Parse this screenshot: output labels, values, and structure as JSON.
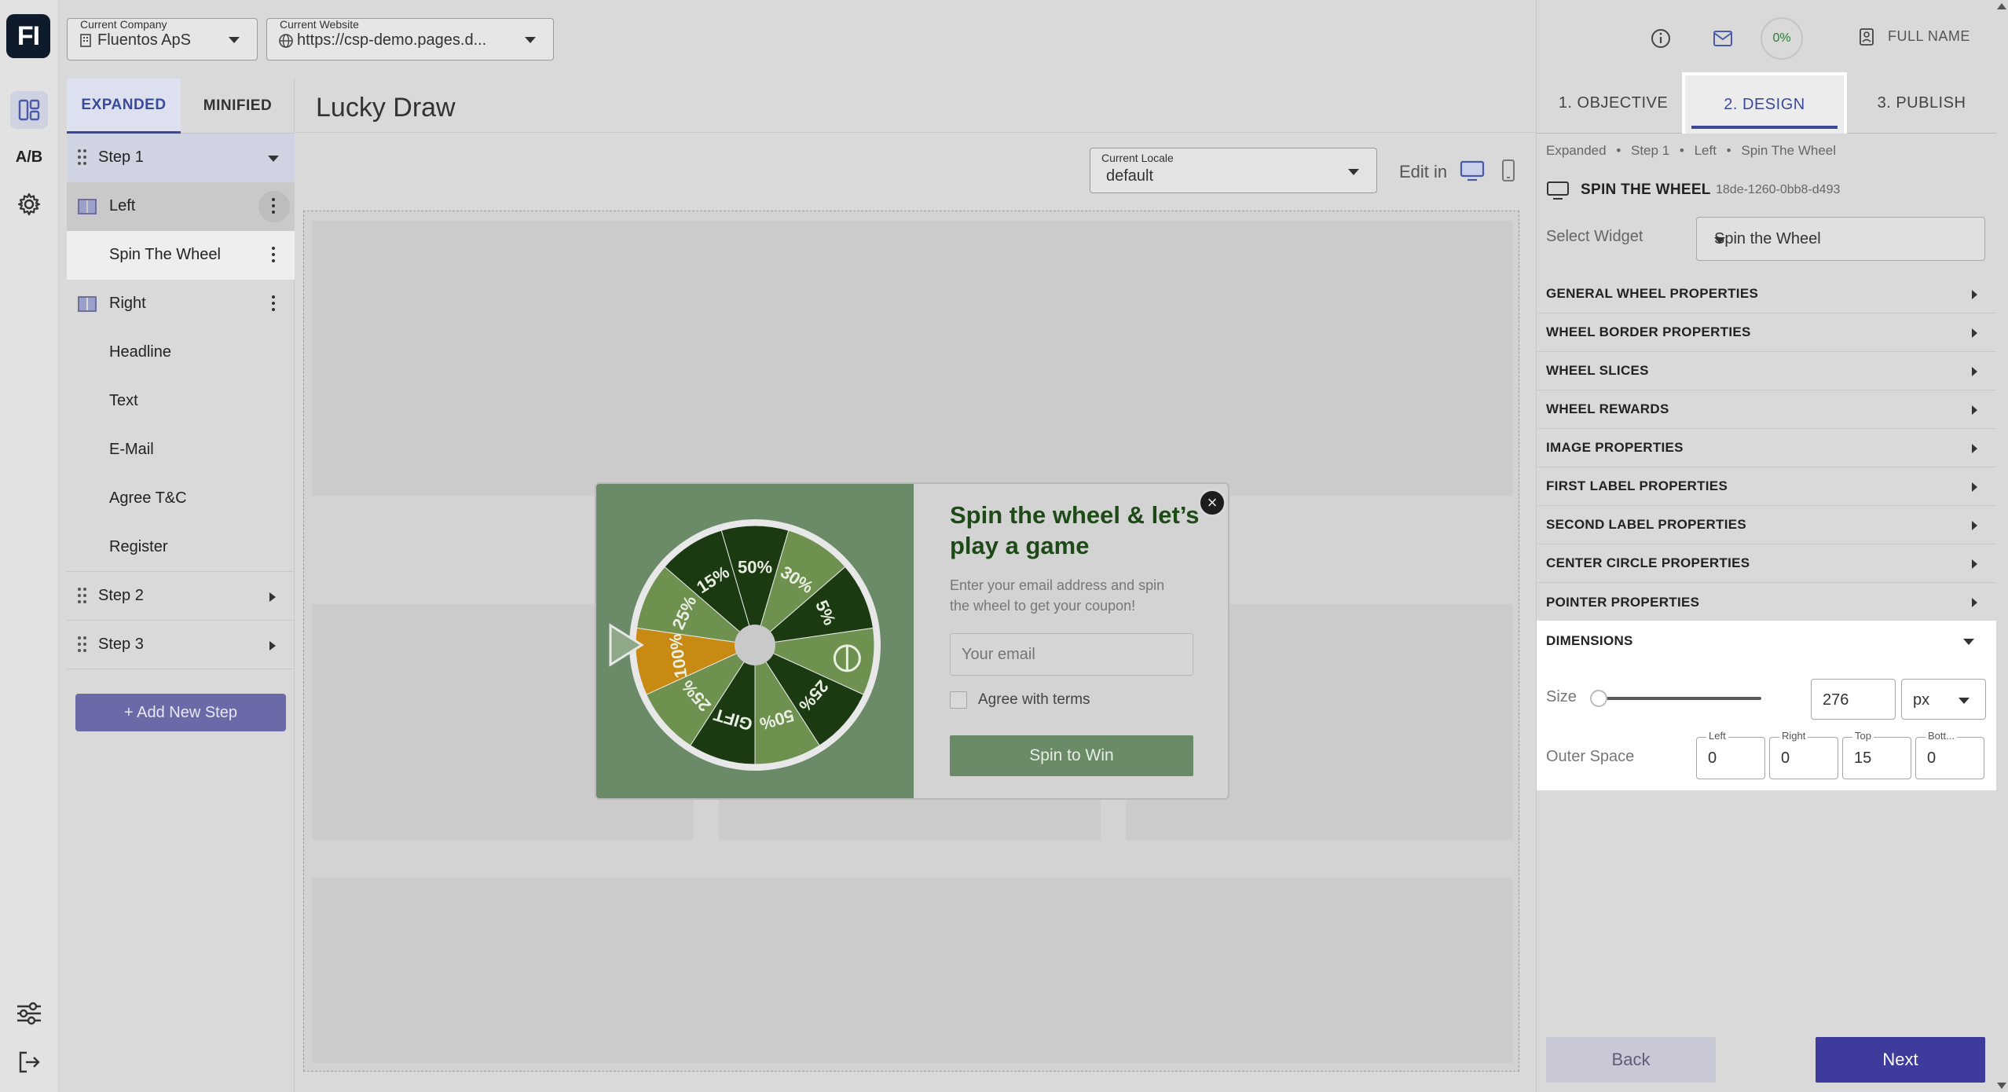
{
  "app": {
    "logo_text": "FI",
    "ab_label": "A/B"
  },
  "topbar": {
    "company": {
      "label": "Current Company",
      "value": "Fluentos ApS"
    },
    "website": {
      "label": "Current Website",
      "value": "https://csp-demo.pages.d..."
    }
  },
  "tree": {
    "tabs": [
      {
        "label": "EXPANDED",
        "active": true
      },
      {
        "label": "MINIFIED",
        "active": false
      }
    ],
    "items": {
      "step1": "Step 1",
      "left": "Left",
      "spin_wheel": "Spin The Wheel",
      "right": "Right",
      "headline": "Headline",
      "text": "Text",
      "email": "E-Mail",
      "agree": "Agree T&C",
      "register": "Register",
      "step2": "Step 2",
      "step3": "Step 3"
    },
    "add_step": "+ Add New Step"
  },
  "main": {
    "title": "Lucky Draw",
    "locale": {
      "label": "Current Locale",
      "value": "default"
    },
    "edit_in": "Edit in"
  },
  "popup": {
    "headline": "Spin the wheel & let’s play a game",
    "text": "Enter your email address and spin the wheel to get your coupon!",
    "email_placeholder": "Your email",
    "agree_label": "Agree with terms",
    "button": "Spin to Win",
    "close": "×",
    "wheel_slices": [
      "50%",
      "30%",
      "5%",
      "",
      "25%",
      "50%",
      "GIFT",
      "25%",
      "100%",
      "25%",
      "15%"
    ]
  },
  "panel": {
    "progress": "0%",
    "user": "FULL NAME",
    "tabs": [
      "1. OBJECTIVE",
      "2. DESIGN",
      "3. PUBLISH"
    ],
    "breadcrumb": [
      "Expanded",
      "Step 1",
      "Left",
      "Spin The Wheel"
    ],
    "widget_title": "SPIN THE WHEEL",
    "widget_id": "18de-1260-0bb8-d493",
    "select_widget_label": "Select Widget",
    "select_widget_value": "Spin the Wheel",
    "properties": [
      "GENERAL WHEEL PROPERTIES",
      "WHEEL BORDER PROPERTIES",
      "WHEEL SLICES",
      "WHEEL REWARDS",
      "IMAGE PROPERTIES",
      "FIRST LABEL PROPERTIES",
      "SECOND LABEL PROPERTIES",
      "CENTER CIRCLE PROPERTIES",
      "POINTER PROPERTIES"
    ],
    "dimensions": {
      "title": "DIMENSIONS",
      "size_label": "Size",
      "size_value": "276",
      "unit": "px",
      "outer_label": "Outer Space",
      "fields": [
        {
          "label": "Left",
          "value": "0"
        },
        {
          "label": "Right",
          "value": "0"
        },
        {
          "label": "Top",
          "value": "15"
        },
        {
          "label": "Bott...",
          "value": "0"
        }
      ]
    },
    "back": "Back",
    "next": "Next"
  },
  "colors": {
    "accent": "#3e3b9c",
    "wheel_dark": "#1b3a12",
    "wheel_light": "#6f9150",
    "wheel_gold": "#c98a14",
    "popup_green": "#6b8a67"
  }
}
